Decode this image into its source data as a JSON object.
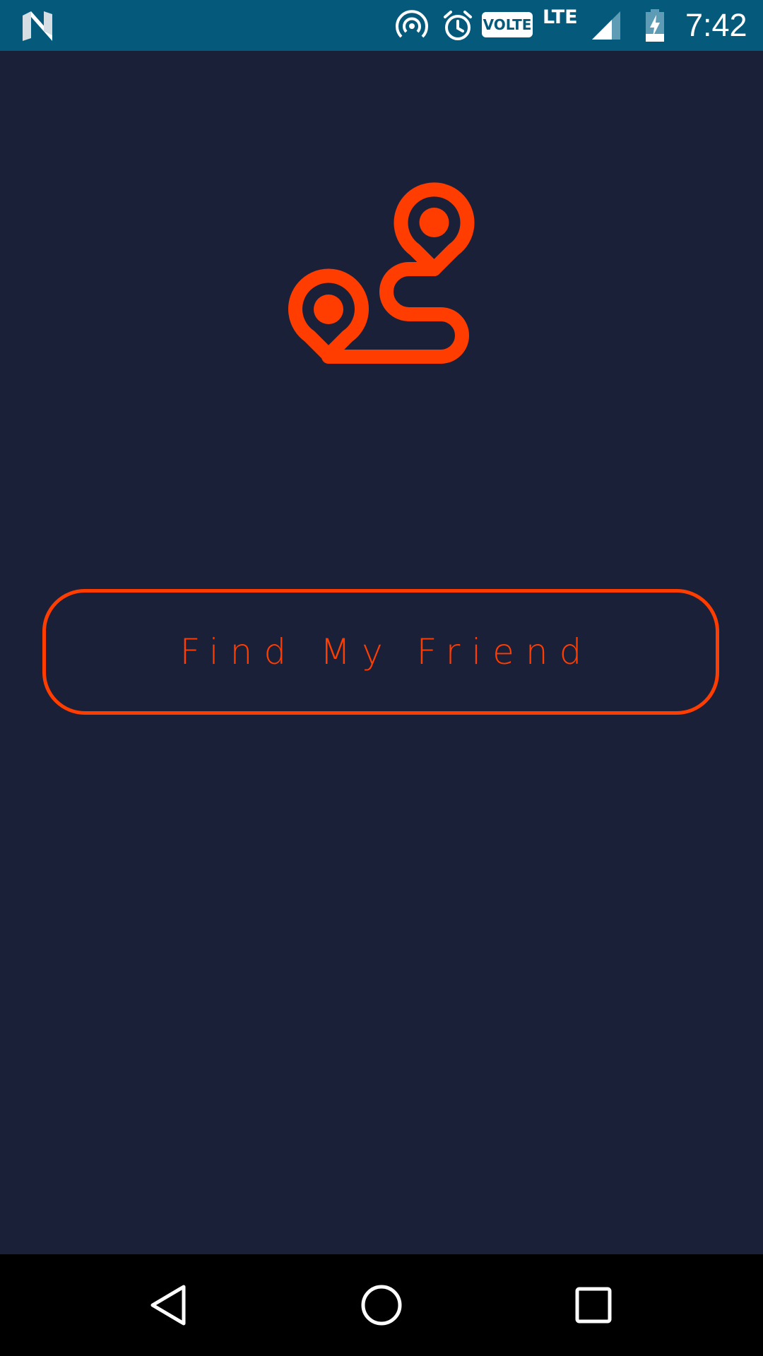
{
  "status_bar": {
    "time": "7:42",
    "volte": "VOLTE",
    "network": "LTE",
    "icons": [
      "android-n-icon",
      "hotspot-icon",
      "alarm-icon",
      "volte-icon",
      "signal-icon",
      "battery-charging-icon"
    ]
  },
  "main": {
    "logo_icon": "route-pins-icon",
    "find_button_label": "Find My Friend"
  },
  "nav_bar": {
    "icons": [
      "back-icon",
      "home-icon",
      "recents-icon"
    ]
  },
  "colors": {
    "background": "#1b2039",
    "status_bar": "#055a7c",
    "accent": "#ff3d00",
    "nav_bar": "#000000"
  }
}
